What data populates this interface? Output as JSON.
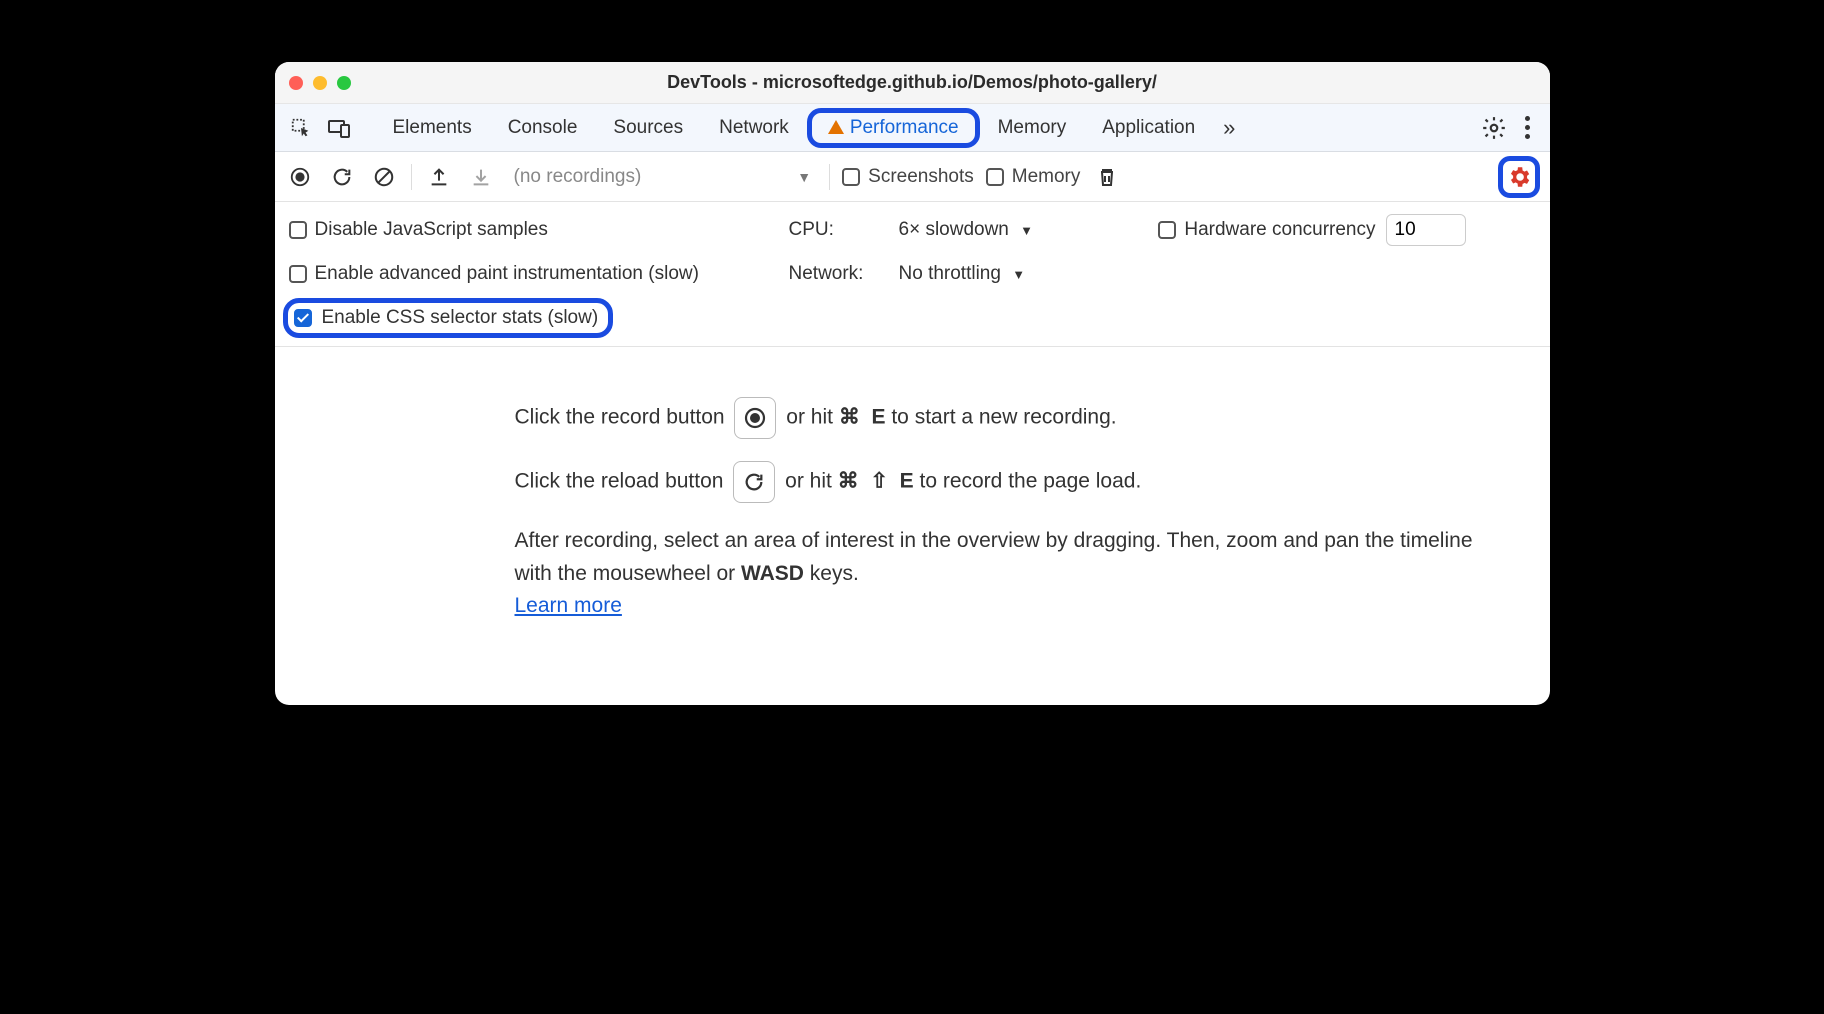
{
  "window": {
    "title": "DevTools - microsoftedge.github.io/Demos/photo-gallery/"
  },
  "tabs": {
    "items": [
      "Elements",
      "Console",
      "Sources",
      "Network",
      "Performance",
      "Memory",
      "Application"
    ],
    "active": "Performance"
  },
  "toolbar": {
    "recordings_placeholder": "(no recordings)",
    "screenshots_label": "Screenshots",
    "memory_label": "Memory"
  },
  "options": {
    "disable_js_label": "Disable JavaScript samples",
    "disable_js_checked": false,
    "cpu_label": "CPU:",
    "cpu_value": "6× slowdown",
    "hw_concurrency_label": "Hardware concurrency",
    "hw_concurrency_value": "10",
    "hw_concurrency_checked": false,
    "advanced_paint_label": "Enable advanced paint instrumentation (slow)",
    "advanced_paint_checked": false,
    "network_label": "Network:",
    "network_value": "No throttling",
    "css_stats_label": "Enable CSS selector stats (slow)",
    "css_stats_checked": true
  },
  "content": {
    "line1a": "Click the record button ",
    "line1b": " or hit ",
    "line1_key1": "⌘",
    "line1_key2": "E",
    "line1c": " to start a new recording.",
    "line2a": "Click the reload button ",
    "line2b": " or hit ",
    "line2_key1": "⌘",
    "line2_key2": "⇧",
    "line2_key3": "E",
    "line2c": " to record the page load.",
    "line3": "After recording, select an area of interest in the overview by dragging. Then, zoom and pan the timeline with the mousewheel or ",
    "line3_wasd": "WASD",
    "line3b": " keys.",
    "learn_more": "Learn more"
  }
}
